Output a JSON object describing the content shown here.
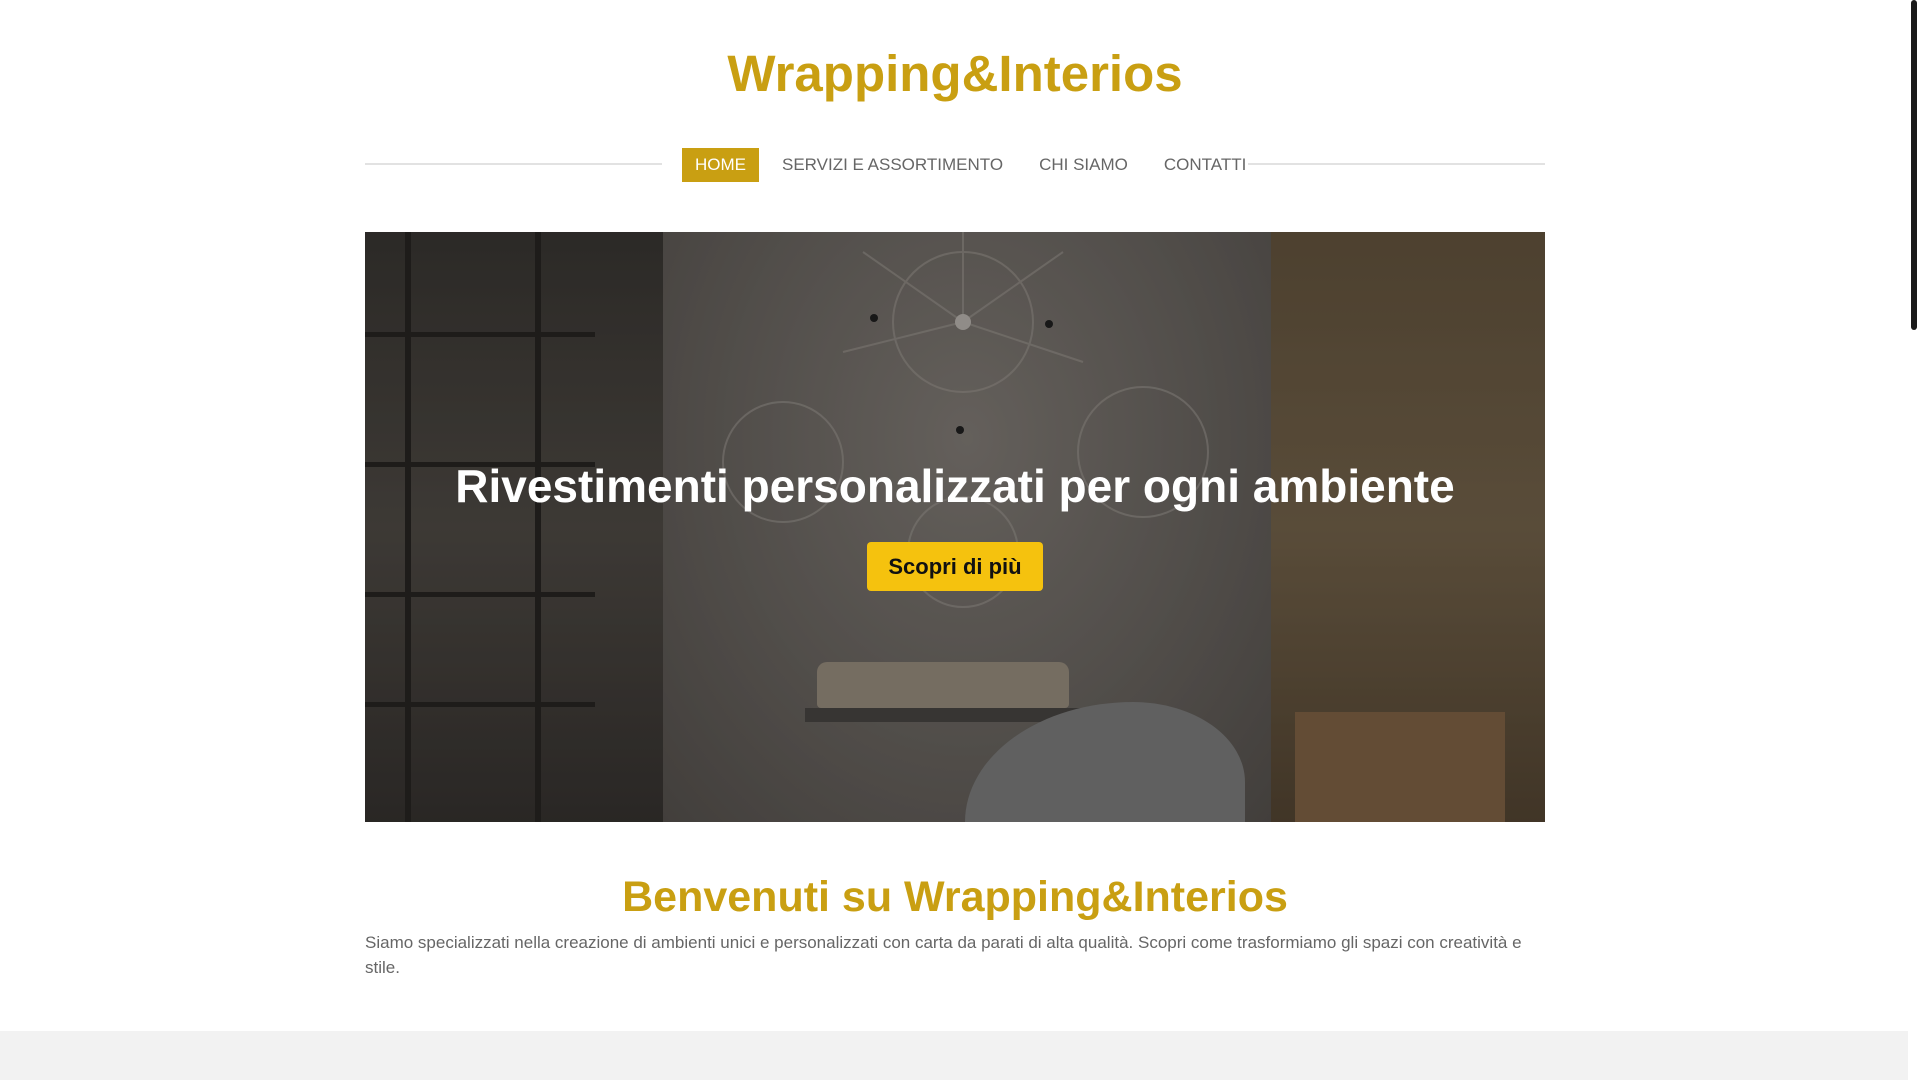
{
  "header": {
    "site_title": "Wrapping&Interios"
  },
  "nav": {
    "items": [
      {
        "label": "HOME",
        "active": true
      },
      {
        "label": "SERVIZI E ASSORTIMENTO",
        "active": false
      },
      {
        "label": "CHI SIAMO",
        "active": false
      },
      {
        "label": "CONTATTI",
        "active": false
      }
    ]
  },
  "hero": {
    "heading": "Rivestimenti personalizzati per ogni ambiente",
    "cta_label": "Scopri di più"
  },
  "welcome": {
    "title": "Benvenuti su Wrapping&Interios",
    "text": "Siamo specializzati nella creazione di ambienti unici e personalizzati con carta da parati di alta qualità. Scopri come trasformiamo gli spazi con creatività e stile."
  },
  "colors": {
    "accent": "#c99f12",
    "cta": "#f5c20e",
    "text": "#666666"
  }
}
